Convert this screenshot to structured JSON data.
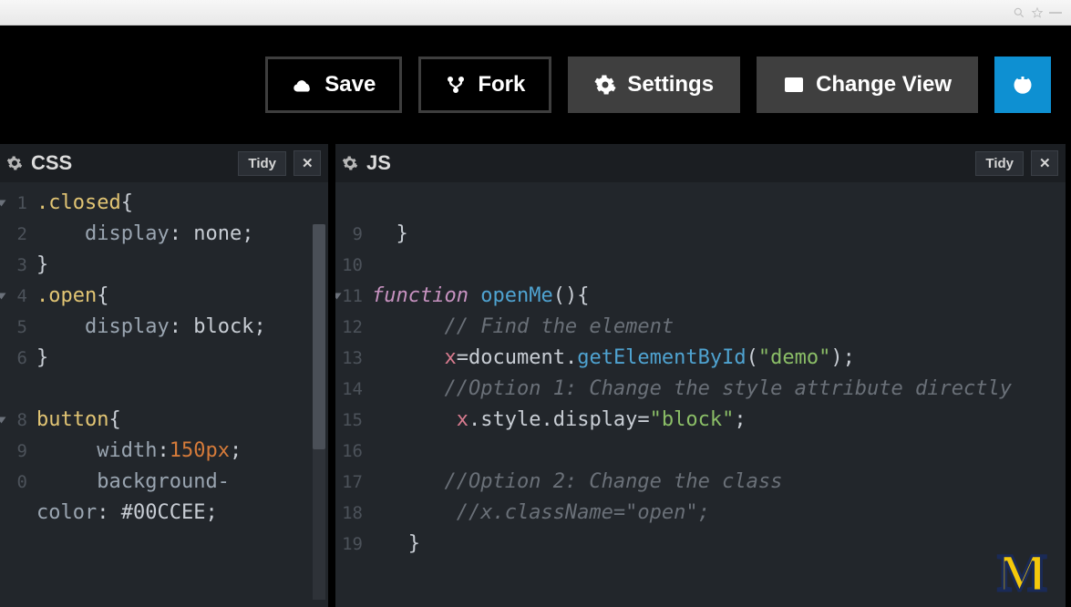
{
  "toolbar": {
    "save": "Save",
    "fork": "Fork",
    "settings": "Settings",
    "change_view": "Change View"
  },
  "panels": {
    "css": {
      "title": "CSS",
      "tidy": "Tidy",
      "close": "✕",
      "lines": [
        {
          "n": "1",
          "fold": true,
          "html": "<span class='t-sel'>.closed</span><span class='t-punc'>{</span>"
        },
        {
          "n": "2",
          "fold": false,
          "html": "    <span class='t-prop'>display</span><span class='t-punc'>: </span><span class='t-val'>none</span><span class='t-punc'>;</span>"
        },
        {
          "n": "3",
          "fold": false,
          "html": "<span class='t-punc'>}</span>"
        },
        {
          "n": "4",
          "fold": true,
          "html": "<span class='t-sel'>.open</span><span class='t-punc'>{</span>"
        },
        {
          "n": "5",
          "fold": false,
          "html": "    <span class='t-prop'>display</span><span class='t-punc'>: </span><span class='t-val'>block</span><span class='t-punc'>;</span>"
        },
        {
          "n": "6",
          "fold": false,
          "html": "<span class='t-punc'>}</span>"
        },
        {
          "n": "",
          "fold": false,
          "html": ""
        },
        {
          "n": "8",
          "fold": true,
          "html": "<span class='t-sel'>button</span><span class='t-punc'>{</span>"
        },
        {
          "n": "9",
          "fold": false,
          "html": "     <span class='t-prop'>width</span><span class='t-punc'>:</span><span class='t-num'>150px</span><span class='t-punc'>;</span>"
        },
        {
          "n": "0",
          "fold": false,
          "html": "     <span class='t-prop'>background-</span>"
        },
        {
          "n": "",
          "fold": false,
          "html": "<span class='t-prop'>color</span><span class='t-punc'>: </span><span class='t-val'>#00CCEE</span><span class='t-punc'>;</span>"
        }
      ]
    },
    "js": {
      "title": "JS",
      "tidy": "Tidy",
      "close": "✕",
      "lines": [
        {
          "n": "",
          "fold": false,
          "html": ""
        },
        {
          "n": "9",
          "fold": false,
          "html": "  <span class='t-punc'>}</span>"
        },
        {
          "n": "10",
          "fold": false,
          "html": ""
        },
        {
          "n": "11",
          "fold": true,
          "html": "<span class='t-kw'>function</span> <span class='t-func'>openMe</span><span class='t-punc'>(){</span>"
        },
        {
          "n": "12",
          "fold": false,
          "html": "      <span class='t-cmt'>// Find the element</span>"
        },
        {
          "n": "13",
          "fold": false,
          "html": "      <span class='t-var'>x</span><span class='t-punc'>=</span><span class='t-obj'>document</span><span class='t-punc'>.</span><span class='t-method'>getElementById</span><span class='t-punc'>(</span><span class='t-str'>\"demo\"</span><span class='t-punc'>);</span>"
        },
        {
          "n": "14",
          "fold": false,
          "html": "      <span class='t-cmt'>//Option 1: Change the style attribute directly</span>"
        },
        {
          "n": "15",
          "fold": false,
          "html": "       <span class='t-var'>x</span><span class='t-punc'>.</span><span class='t-obj'>style</span><span class='t-punc'>.</span><span class='t-obj'>display</span><span class='t-punc'>=</span><span class='t-str'>\"block\"</span><span class='t-punc'>;</span>"
        },
        {
          "n": "16",
          "fold": false,
          "html": ""
        },
        {
          "n": "17",
          "fold": false,
          "html": "      <span class='t-cmt'>//Option 2: Change the class</span>"
        },
        {
          "n": "18",
          "fold": false,
          "html": "       <span class='t-cmt'>//x.className=\"open\";</span>"
        },
        {
          "n": "19",
          "fold": false,
          "html": "   <span class='t-punc'>}</span>"
        }
      ]
    }
  },
  "logo": "M"
}
